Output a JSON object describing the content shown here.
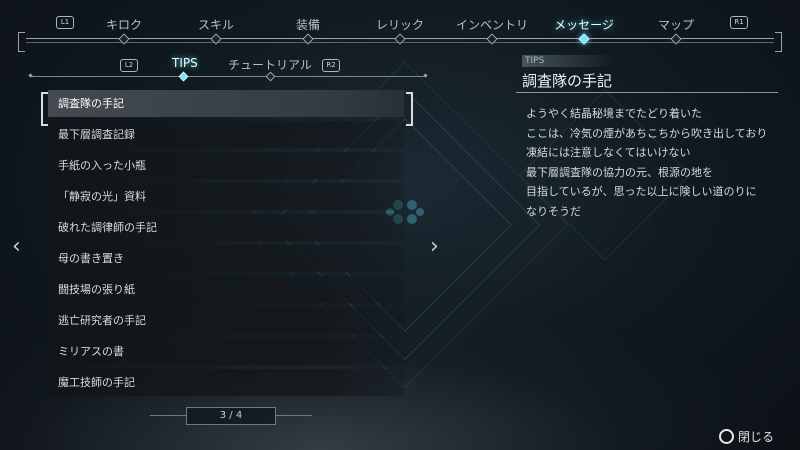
{
  "topnav": {
    "left_button": "L1",
    "right_button": "R1",
    "tabs": [
      "キロク",
      "スキル",
      "装備",
      "レリック",
      "インベントリ",
      "メッセージ",
      "マップ"
    ],
    "active_tab": "メッセージ"
  },
  "subtabs": {
    "left_button": "L2",
    "right_button": "R2",
    "tabs": [
      "TIPS",
      "チュートリアル"
    ],
    "active_tab": "TIPS"
  },
  "list": {
    "items": [
      "調査隊の手記",
      "最下層調査記録",
      "手紙の入った小瓶",
      "「静寂の光」資料",
      "破れた調律師の手記",
      "母の書き置き",
      "闘技場の張り紙",
      "逃亡研究者の手記",
      "ミリアスの書",
      "魔工技師の手記"
    ],
    "selected_index": 0,
    "page": "3 / 4"
  },
  "detail": {
    "category": "TIPS",
    "title": "調査隊の手記",
    "lines": [
      "ようやく結晶秘境までたどり着いた",
      "ここは、冷気の煙があちこちから吹き出しており",
      "凍結には注意しなくてはいけない",
      "最下層調査隊の協力の元、根源の地を",
      "目指しているが、思った以上に険しい道のりに",
      "なりそうだ"
    ]
  },
  "footer": {
    "close_label": "閉じる",
    "close_icon": "circle-button-icon"
  },
  "colors": {
    "accent": "#5ad3e6",
    "background": "#111a21"
  }
}
